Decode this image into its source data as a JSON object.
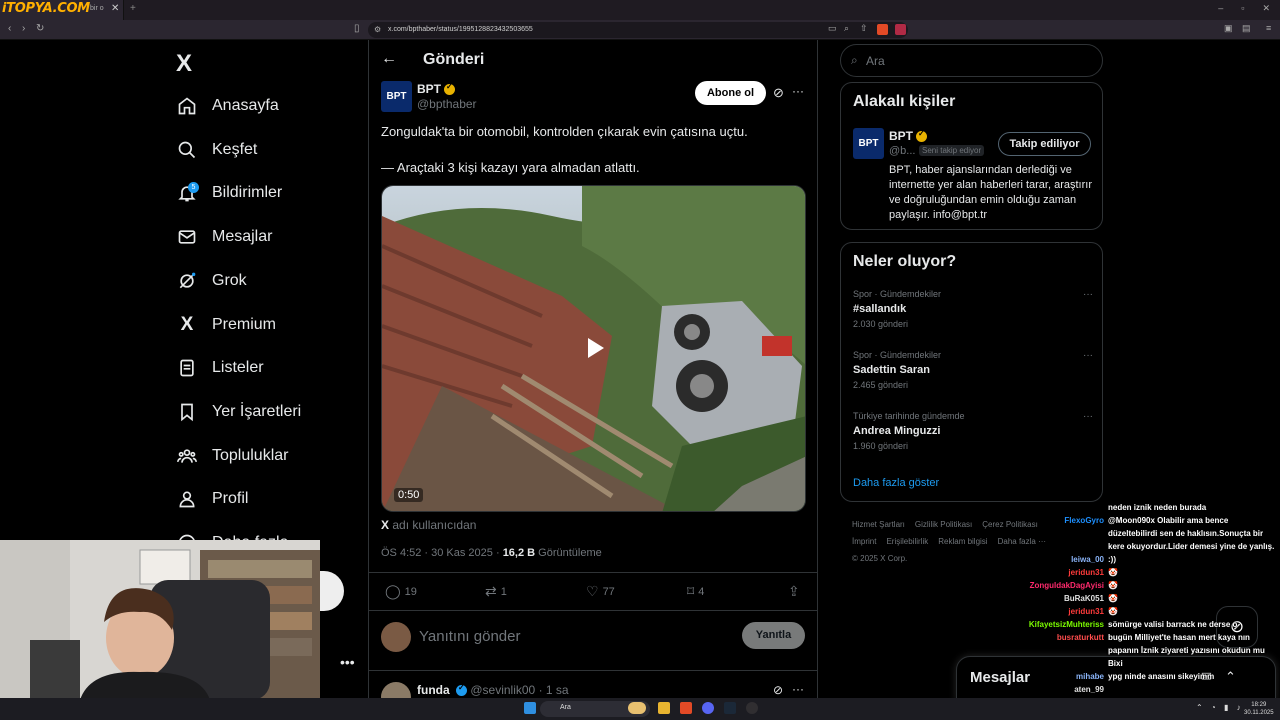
{
  "browser": {
    "tab_logo": "iTOPYA.COM",
    "tab_title": "bir o",
    "url": "x.com/bpthaber/status/1995128823432503655"
  },
  "sidebar": {
    "logo": "X",
    "items": [
      {
        "label": "Anasayfa",
        "icon": "home-icon"
      },
      {
        "label": "Keşfet",
        "icon": "search-icon"
      },
      {
        "label": "Bildirimler",
        "icon": "bell-icon",
        "badge": "5"
      },
      {
        "label": "Mesajlar",
        "icon": "mail-icon"
      },
      {
        "label": "Grok",
        "icon": "grok-icon"
      },
      {
        "label": "Premium",
        "icon": "x-icon"
      },
      {
        "label": "Listeler",
        "icon": "list-icon"
      },
      {
        "label": "Yer İşaretleri",
        "icon": "bookmark-icon"
      },
      {
        "label": "Topluluklar",
        "icon": "people-icon"
      },
      {
        "label": "Profil",
        "icon": "person-icon"
      },
      {
        "label": "Daha fazla",
        "icon": "more-icon"
      }
    ]
  },
  "main": {
    "header_title": "Gönderi",
    "tweet": {
      "author_name": "BPT",
      "author_handle": "@bpthaber",
      "avatar_text": "BPT",
      "subscribe_label": "Abone ol",
      "text_line1": "Zonguldak'ta bir otomobil, kontrolden çıkarak evin çatısına uçtu.",
      "text_line2": "— Araçtaki 3 kişi kazayı yara almadan atlattı.",
      "video_time": "0:50",
      "source_x": "X",
      "source_text": "adı kullanıcıdan",
      "time": "ÖS 4:52 · 30 Kas 2025 · ",
      "views_count": "16,2 B",
      "views_label": " Görüntüleme",
      "replies": "19",
      "reposts": "1",
      "likes": "77",
      "bookmarks": "4"
    },
    "reply_placeholder": "Yanıtını gönder",
    "reply_button": "Yanıtla",
    "comment": {
      "name": "funda",
      "handle": "@sevinlik00 · 1 sa"
    }
  },
  "right": {
    "search_placeholder": "Ara",
    "related_title": "Alakalı kişiler",
    "related": {
      "name": "BPT",
      "handle": "@b...",
      "follows_you": "Seni takip ediyor",
      "button": "Takip ediliyor",
      "bio": "BPT, haber ajanslarından derlediği ve internette yer alan haberleri tarar, araştırır ve doğruluğundan emin olduğu zaman paylaşır. info@bpt.tr"
    },
    "trends_title": "Neler oluyor?",
    "trends": [
      {
        "context": "Spor · Gündemdekiler",
        "name": "#sallandık",
        "count": "2.030 gönderi"
      },
      {
        "context": "Spor · Gündemdekiler",
        "name": "Sadettin Saran",
        "count": "2.465 gönderi"
      },
      {
        "context": "Türkiye tarihinde gündemde",
        "name": "Andrea Minguzzi",
        "count": "1.960 gönderi"
      }
    ],
    "show_more": "Daha fazla göster",
    "footer": [
      "Hizmet Şartları",
      "Gizlilik Politikası",
      "Çerez Politikası",
      "İmprint",
      "Erişilebilirlik",
      "Reklam bilgisi",
      "Daha fazla ···",
      "© 2025 X Corp."
    ]
  },
  "messages": {
    "title": "Mesajlar"
  },
  "chat": [
    {
      "user": "",
      "msg": "neden iznik neden burada",
      "color": "#ffffff"
    },
    {
      "user": "FlexoGyro",
      "msg": "@Moon090x Olabilir ama bence düzeltebilirdi sen de haklısın.Sonuçta bir kere okuyordur.Lider demesi yine de yanlış.",
      "color": "#1e90ff"
    },
    {
      "user": "leiwa_00",
      "msg": ":))",
      "color": "#8ab4f8"
    },
    {
      "user": "jeridun31",
      "msg": "🤡",
      "color": "#ff3b3b"
    },
    {
      "user": "ZonguldakDagAyisi",
      "msg": "🤡",
      "color": "#ff2a6d"
    },
    {
      "user": "BuRaK051",
      "msg": "🤡",
      "color": "#e0e0e0"
    },
    {
      "user": "jeridun31",
      "msg": "🤡",
      "color": "#ff3b3b"
    },
    {
      "user": "KifayetsizMuhteriss",
      "msg": "sömürge valisi barrack ne derse o",
      "color": "#7cfc00"
    },
    {
      "user": "busraturkutt",
      "msg": "bugün Milliyet'te hasan mert kaya nın papanın İznik ziyareti yazısını okudun mu Bixi",
      "color": "#ff4d4d"
    },
    {
      "user": "mihabe",
      "msg": "ypg ninde anasını sikeyimm",
      "color": "#8ab4f8"
    },
    {
      "user": "aten_99",
      "msg": "",
      "color": "#e0e0e0"
    }
  ],
  "taskbar": {
    "search": "Ara",
    "time": "18:29",
    "date": "30.11.2025"
  }
}
